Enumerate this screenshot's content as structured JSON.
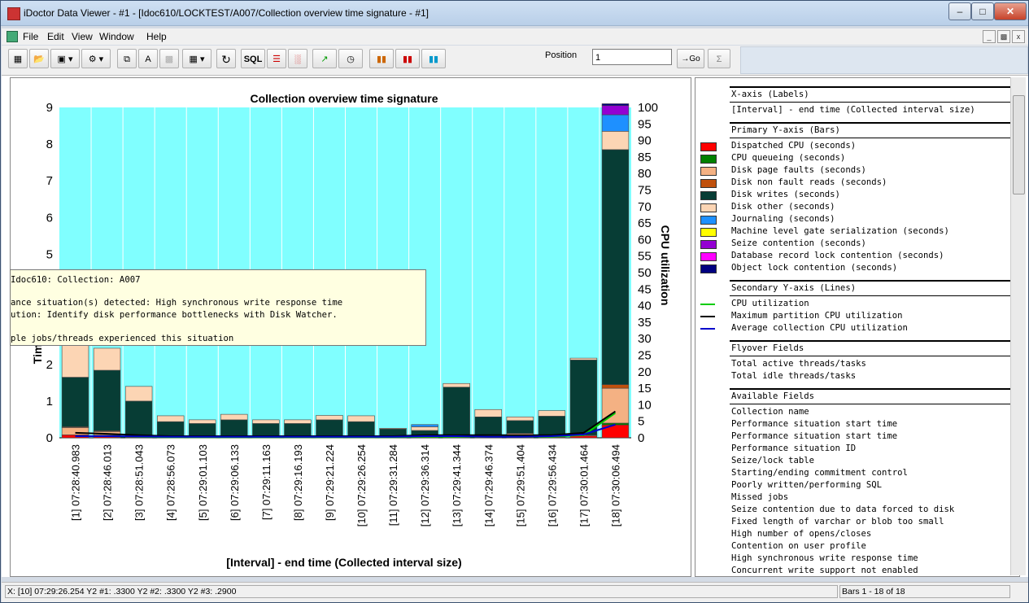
{
  "window": {
    "title": "iDoctor Data Viewer - #1 - [Idoc610/LOCKTEST/A007/Collection overview time signature - #1]"
  },
  "menu": [
    "File",
    "Edit",
    "View",
    "Window",
    "Help"
  ],
  "toolbar": {
    "position_label": "Position",
    "position_value": "1",
    "go_label": "→Go",
    "sum_label": "Σ",
    "sql_label": "SQL",
    "font_label": "A"
  },
  "chart_data": {
    "type": "bar",
    "title": "Collection overview time signature",
    "xlabel": "[Interval] - end time (Collected interval size)",
    "ylabel": "Time (seconds)",
    "y2label": "CPU utilization",
    "ylim": [
      0,
      9
    ],
    "y2lim": [
      0,
      100
    ],
    "yticks": [
      0,
      1,
      2,
      3,
      4,
      5,
      6,
      7,
      8,
      9
    ],
    "y2ticks": [
      0,
      5,
      10,
      15,
      20,
      25,
      30,
      35,
      40,
      45,
      50,
      55,
      60,
      65,
      70,
      75,
      80,
      85,
      90,
      95,
      100
    ],
    "categories": [
      "[1] 07:28:40.983",
      "[2] 07:28:46.013",
      "[3] 07:28:51.043",
      "[4] 07:28:56.073",
      "[5] 07:29:01.103",
      "[6] 07:29:06.133",
      "[7] 07:29:11.163",
      "[8] 07:29:16.193",
      "[9] 07:29:21.224",
      "[10] 07:29:26.254",
      "[11] 07:29:31.284",
      "[12] 07:29:36.314",
      "[13] 07:29:41.344",
      "[14] 07:29:46.374",
      "[15] 07:29:51.404",
      "[16] 07:29:56.434",
      "[17] 07:30:01.464",
      "[18] 07:30:06.494"
    ],
    "series": [
      {
        "name": "Dispatched CPU (seconds)",
        "color": "#ff0000",
        "values": [
          0.08,
          0.07,
          0.03,
          0.02,
          0.02,
          0.02,
          0.02,
          0.02,
          0.02,
          0.02,
          0.02,
          0.03,
          0.03,
          0.02,
          0.02,
          0.02,
          0.05,
          0.35
        ]
      },
      {
        "name": "CPU queueing (seconds)",
        "color": "#008000",
        "values": [
          0,
          0,
          0,
          0,
          0,
          0,
          0,
          0,
          0,
          0,
          0,
          0,
          0,
          0,
          0,
          0,
          0,
          0.05
        ]
      },
      {
        "name": "Disk page faults (seconds)",
        "color": "#f4b183",
        "values": [
          0.2,
          0.1,
          0.02,
          0.02,
          0.02,
          0.02,
          0.02,
          0.02,
          0.02,
          0.02,
          0.02,
          0.02,
          0.05,
          0.05,
          0.1,
          0.02,
          0.02,
          0.95
        ]
      },
      {
        "name": "Disk non fault reads (seconds)",
        "color": "#c0500c",
        "values": [
          0.02,
          0.02,
          0,
          0,
          0,
          0,
          0,
          0,
          0,
          0,
          0,
          0,
          0,
          0,
          0,
          0,
          0,
          0.1
        ]
      },
      {
        "name": "Disk writes (seconds)",
        "color": "#073d35",
        "values": [
          1.35,
          1.65,
          0.95,
          0.4,
          0.35,
          0.45,
          0.35,
          0.35,
          0.45,
          0.4,
          0.2,
          0.15,
          1.3,
          0.5,
          0.35,
          0.55,
          2.05,
          6.4
        ]
      },
      {
        "name": "Disk other (seconds)",
        "color": "#fcd5b4",
        "values": [
          1.5,
          0.6,
          0.4,
          0.16,
          0.1,
          0.15,
          0.1,
          0.1,
          0.12,
          0.16,
          0.02,
          0.1,
          0.1,
          0.2,
          0.1,
          0.15,
          0.05,
          0.5
        ]
      },
      {
        "name": "Journaling (seconds)",
        "color": "#1e90ff",
        "values": [
          0.15,
          0,
          0,
          0,
          0,
          0,
          0,
          0,
          0,
          0,
          0,
          0.06,
          0,
          0,
          0,
          0,
          0,
          0.45
        ]
      },
      {
        "name": "Machine level gate serialization (seconds)",
        "color": "#ffff00",
        "values": [
          0,
          0,
          0,
          0,
          0,
          0,
          0,
          0,
          0,
          0,
          0,
          0,
          0,
          0,
          0,
          0,
          0,
          0
        ]
      },
      {
        "name": "Seize contention (seconds)",
        "color": "#9400d3",
        "values": [
          0,
          0,
          0,
          0,
          0,
          0,
          0,
          0,
          0,
          0,
          0,
          0,
          0,
          0,
          0,
          0,
          0,
          0.25
        ]
      },
      {
        "name": "Database record lock contention (seconds)",
        "color": "#ff00ff",
        "values": [
          0,
          0,
          0,
          0,
          0,
          0,
          0,
          0,
          0,
          0,
          0,
          0,
          0,
          0,
          0,
          0,
          0,
          0
        ]
      },
      {
        "name": "Object lock contention (seconds)",
        "color": "#000080",
        "values": [
          0,
          0,
          0,
          0,
          0,
          0,
          0,
          0,
          0,
          0,
          0,
          0,
          0,
          0,
          0,
          0,
          0,
          0.05
        ]
      }
    ],
    "lines": [
      {
        "name": "CPU utilization",
        "color": "#00cc00",
        "values": [
          0.5,
          0.5,
          0.3,
          0.2,
          0.2,
          0.2,
          0.2,
          0.2,
          0.2,
          0.2,
          0.2,
          0.3,
          0.3,
          0.3,
          0.3,
          0.3,
          0.8,
          7.5
        ]
      },
      {
        "name": "Maximum partition CPU utilization",
        "color": "#000000",
        "values": [
          1.5,
          1.2,
          0.8,
          0.5,
          0.5,
          0.5,
          0.5,
          0.5,
          0.5,
          0.5,
          0.5,
          0.8,
          0.8,
          0.8,
          0.8,
          0.8,
          1.5,
          8.0
        ]
      },
      {
        "name": "Average collection CPU utilization",
        "color": "#0000cc",
        "values": [
          0.5,
          0.5,
          0.4,
          0.3,
          0.3,
          0.3,
          0.3,
          0.3,
          0.3,
          0.3,
          0.3,
          0.5,
          0.5,
          0.3,
          0.3,
          0.5,
          1.0,
          4.0
        ]
      }
    ],
    "background": "#80ffff",
    "grid": "vertical"
  },
  "legend": {
    "xaxis_header": "X-axis (Labels)",
    "xaxis_value": "[Interval] - end time (Collected interval size)",
    "primary_header": "Primary Y-axis (Bars)",
    "secondary_header": "Secondary Y-axis (Lines)",
    "flyover_header": "Flyover Fields",
    "flyover": [
      "Total active threads/tasks",
      "Total idle threads/tasks"
    ],
    "available_header": "Available Fields",
    "available": [
      "Collection name",
      "Performance situation start time",
      "Performance situation start time",
      "Performance situation ID",
      "Seize/lock table",
      "Starting/ending commitment control",
      "Poorly written/performing SQL",
      "Missed jobs",
      "Seize contention due to data forced to disk",
      "Fixed length of varchar or blob too small",
      "High number of opens/closes",
      "Contention on user profile",
      "High synchronous write response time",
      "Concurrent write support not enabled"
    ]
  },
  "tooltip": {
    "line1": "Idoc610:  Collection: A007",
    "line2": "ance situation(s) detected: High synchronous write response time",
    "line3": "ution:  Identify disk performance bottlenecks with Disk Watcher.",
    "line4": "ple jobs/threads experienced this situation"
  },
  "status": {
    "left": "X: [10] 07:29:26.254   Y2 #1: .3300   Y2 #2: .3300   Y2 #3: .2900",
    "right": "Bars 1 - 18 of 18"
  }
}
